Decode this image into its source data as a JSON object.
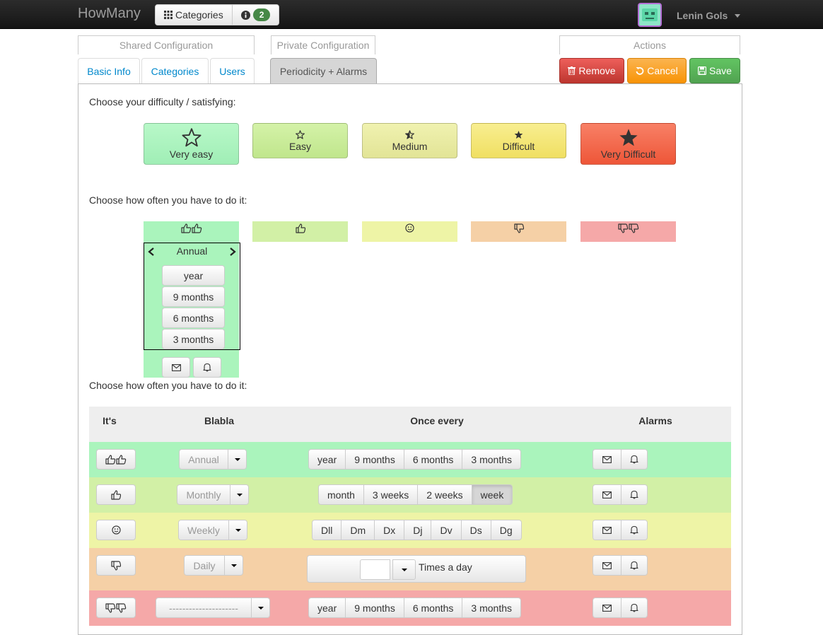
{
  "navbar": {
    "brand": "HowMany",
    "categories_label": "Categories",
    "info_count": "2",
    "user_name": "Lenin Gols"
  },
  "sections": {
    "shared": "Shared Configuration",
    "private": "Private Configuration",
    "actions": "Actions"
  },
  "tabs": [
    "Basic Info",
    "Categories",
    "Users",
    "Periodicity + Alarms"
  ],
  "actions": {
    "remove": "Remove",
    "cancel": "Cancel",
    "save": "Save"
  },
  "difficulty": {
    "prompt": "Choose your difficulty / satisfying:",
    "options": [
      {
        "label": "Very easy",
        "color": "#a8f4bc"
      },
      {
        "label": "Easy",
        "color": "#c9ec9a"
      },
      {
        "label": "Medium",
        "color": "#ebeda3"
      },
      {
        "label": "Difficult",
        "color": "#f5e87a"
      },
      {
        "label": "Very Difficult",
        "color": "#f26a50"
      }
    ]
  },
  "periodicity": {
    "prompt": "Choose how often you have to do it:",
    "colors": [
      "#aaf4bc",
      "#d2f0a6",
      "#eef4a6",
      "#f5d0a6",
      "#f5a8a8"
    ],
    "selector": {
      "title": "Annual",
      "options": [
        "year",
        "9 months",
        "6 months",
        "3 months"
      ]
    }
  },
  "table": {
    "prompt": "Choose how often you have to do it:",
    "headers": [
      "It's",
      "Blabla",
      "Once every",
      "Alarms"
    ],
    "rows": [
      {
        "icon": "two-thumbs-up",
        "select": "Annual",
        "color": "#aaf4bc",
        "choices": [
          "year",
          "9 months",
          "6 months",
          "3 months"
        ],
        "active_index": -1
      },
      {
        "icon": "thumb-up",
        "select": "Monthly",
        "color": "#d2f0a6",
        "choices": [
          "month",
          "3 weeks",
          "2 weeks",
          "week"
        ],
        "active_index": 3
      },
      {
        "icon": "smile",
        "select": "Weekly",
        "color": "#eef4a6",
        "choices": [
          "Dll",
          "Dm",
          "Dx",
          "Dj",
          "Dv",
          "Ds",
          "Dg"
        ],
        "active_index": -1
      },
      {
        "icon": "thumb-down",
        "select": "Daily",
        "color": "#f5d0a6",
        "times_label": "Times a day"
      },
      {
        "icon": "two-thumbs-down",
        "select": "---------------------",
        "color": "#f5a8a8",
        "choices": [
          "year",
          "9 months",
          "6 months",
          "3 months"
        ],
        "active_index": -1
      }
    ]
  }
}
